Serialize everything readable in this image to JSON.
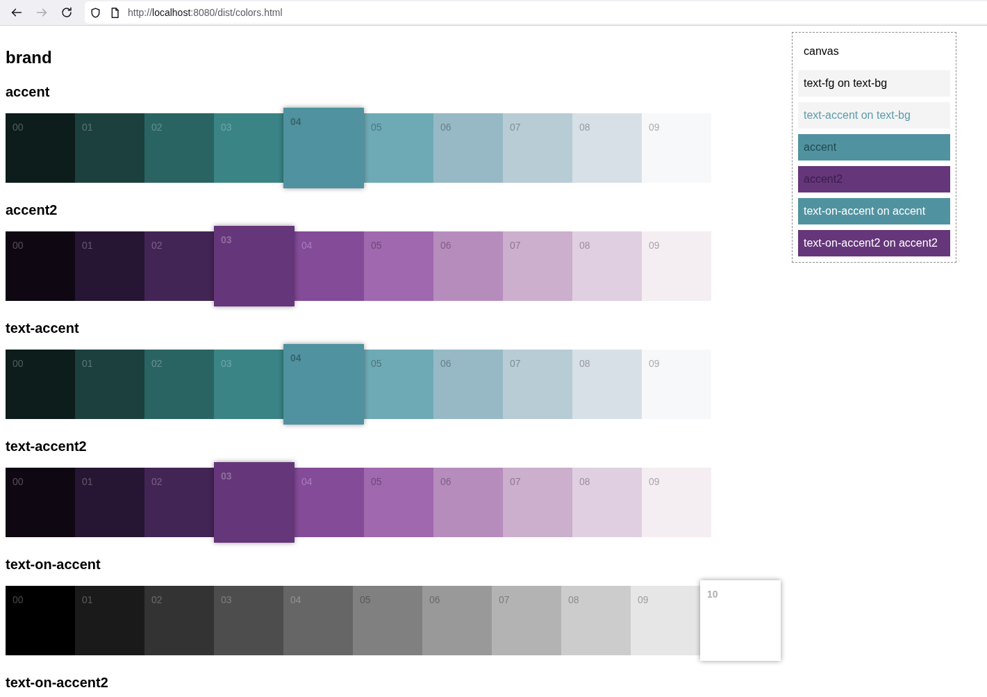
{
  "browser": {
    "nav_buttons": [
      {
        "kind": "back",
        "disabled": false
      },
      {
        "kind": "forward",
        "disabled": true
      },
      {
        "kind": "reload",
        "disabled": false
      }
    ],
    "address": {
      "prefix": "http://",
      "host": "localhost",
      "path": ":8080/dist/colors.html"
    }
  },
  "page": {
    "title": "brand",
    "sections": [
      {
        "name": "accent",
        "swatches": [
          {
            "label": "00",
            "color": "#0c1d1b",
            "selected": false
          },
          {
            "label": "01",
            "color": "#1b403e",
            "selected": false
          },
          {
            "label": "02",
            "color": "#296462",
            "selected": false
          },
          {
            "label": "03",
            "color": "#3a8486",
            "selected": false
          },
          {
            "label": "04",
            "color": "#5192a0",
            "selected": true
          },
          {
            "label": "05",
            "color": "#6eaab5",
            "selected": false
          },
          {
            "label": "06",
            "color": "#96b9c5",
            "selected": false
          },
          {
            "label": "07",
            "color": "#b8ccd5",
            "selected": false
          },
          {
            "label": "08",
            "color": "#d8e0e7",
            "selected": false
          },
          {
            "label": "09",
            "color": "#f7f8fa",
            "selected": false
          }
        ]
      },
      {
        "name": "accent2",
        "swatches": [
          {
            "label": "00",
            "color": "#0f0813",
            "selected": false
          },
          {
            "label": "01",
            "color": "#261634",
            "selected": false
          },
          {
            "label": "02",
            "color": "#432555",
            "selected": false
          },
          {
            "label": "03",
            "color": "#653679",
            "selected": true
          },
          {
            "label": "04",
            "color": "#844b99",
            "selected": false
          },
          {
            "label": "05",
            "color": "#a068ae",
            "selected": false
          },
          {
            "label": "06",
            "color": "#b68cbd",
            "selected": false
          },
          {
            "label": "07",
            "color": "#ccaecd",
            "selected": false
          },
          {
            "label": "08",
            "color": "#e0cfe1",
            "selected": false
          },
          {
            "label": "09",
            "color": "#f4eef3",
            "selected": false
          }
        ]
      },
      {
        "name": "text-accent",
        "swatches": [
          {
            "label": "00",
            "color": "#0c1d1b",
            "selected": false
          },
          {
            "label": "01",
            "color": "#1b403e",
            "selected": false
          },
          {
            "label": "02",
            "color": "#296462",
            "selected": false
          },
          {
            "label": "03",
            "color": "#3a8486",
            "selected": false
          },
          {
            "label": "04",
            "color": "#5192a0",
            "selected": true
          },
          {
            "label": "05",
            "color": "#6eaab5",
            "selected": false
          },
          {
            "label": "06",
            "color": "#96b9c5",
            "selected": false
          },
          {
            "label": "07",
            "color": "#b8ccd5",
            "selected": false
          },
          {
            "label": "08",
            "color": "#d8e0e7",
            "selected": false
          },
          {
            "label": "09",
            "color": "#f7f8fa",
            "selected": false
          }
        ]
      },
      {
        "name": "text-accent2",
        "swatches": [
          {
            "label": "00",
            "color": "#0f0813",
            "selected": false
          },
          {
            "label": "01",
            "color": "#261634",
            "selected": false
          },
          {
            "label": "02",
            "color": "#432555",
            "selected": false
          },
          {
            "label": "03",
            "color": "#653679",
            "selected": true
          },
          {
            "label": "04",
            "color": "#844b99",
            "selected": false
          },
          {
            "label": "05",
            "color": "#a068ae",
            "selected": false
          },
          {
            "label": "06",
            "color": "#b68cbd",
            "selected": false
          },
          {
            "label": "07",
            "color": "#ccaecd",
            "selected": false
          },
          {
            "label": "08",
            "color": "#e0cfe1",
            "selected": false
          },
          {
            "label": "09",
            "color": "#f4eef3",
            "selected": false
          }
        ]
      },
      {
        "name": "text-on-accent",
        "swatches": [
          {
            "label": "00",
            "color": "#000000",
            "selected": false
          },
          {
            "label": "01",
            "color": "#1a1a1a",
            "selected": false
          },
          {
            "label": "02",
            "color": "#333333",
            "selected": false
          },
          {
            "label": "03",
            "color": "#4d4d4d",
            "selected": false
          },
          {
            "label": "04",
            "color": "#666666",
            "selected": false
          },
          {
            "label": "05",
            "color": "#808080",
            "selected": false
          },
          {
            "label": "06",
            "color": "#999999",
            "selected": false
          },
          {
            "label": "07",
            "color": "#b3b3b3",
            "selected": false
          },
          {
            "label": "08",
            "color": "#cccccc",
            "selected": false
          },
          {
            "label": "09",
            "color": "#e6e6e6",
            "selected": false
          },
          {
            "label": "10",
            "color": "#ffffff",
            "selected": true
          }
        ]
      },
      {
        "name": "text-on-accent2"
      }
    ]
  },
  "sample_panel": {
    "items": [
      {
        "color": "#ffffff",
        "text": {
          "label": "canvas",
          "color": "#000000"
        }
      },
      {
        "color": "#f4f4f4",
        "text": {
          "label": "text-fg on text-bg",
          "color": "#000000"
        }
      },
      {
        "color": "#f4f4f4",
        "text": {
          "label": "text-accent on text-bg",
          "color": "#5a9dab"
        }
      },
      {
        "color": "#5192a0",
        "text": {
          "label": "accent",
          "color": "#1f4a50"
        }
      },
      {
        "color": "#653679",
        "text": {
          "label": "accent2",
          "color": "#3a1d4a"
        }
      },
      {
        "color": "#5192a0",
        "text": {
          "label": "text-on-accent on accent",
          "color": "#ffffff"
        }
      },
      {
        "color": "#653679",
        "text": {
          "label": "text-on-accent2 on accent2",
          "color": "#ffffff"
        }
      }
    ]
  }
}
